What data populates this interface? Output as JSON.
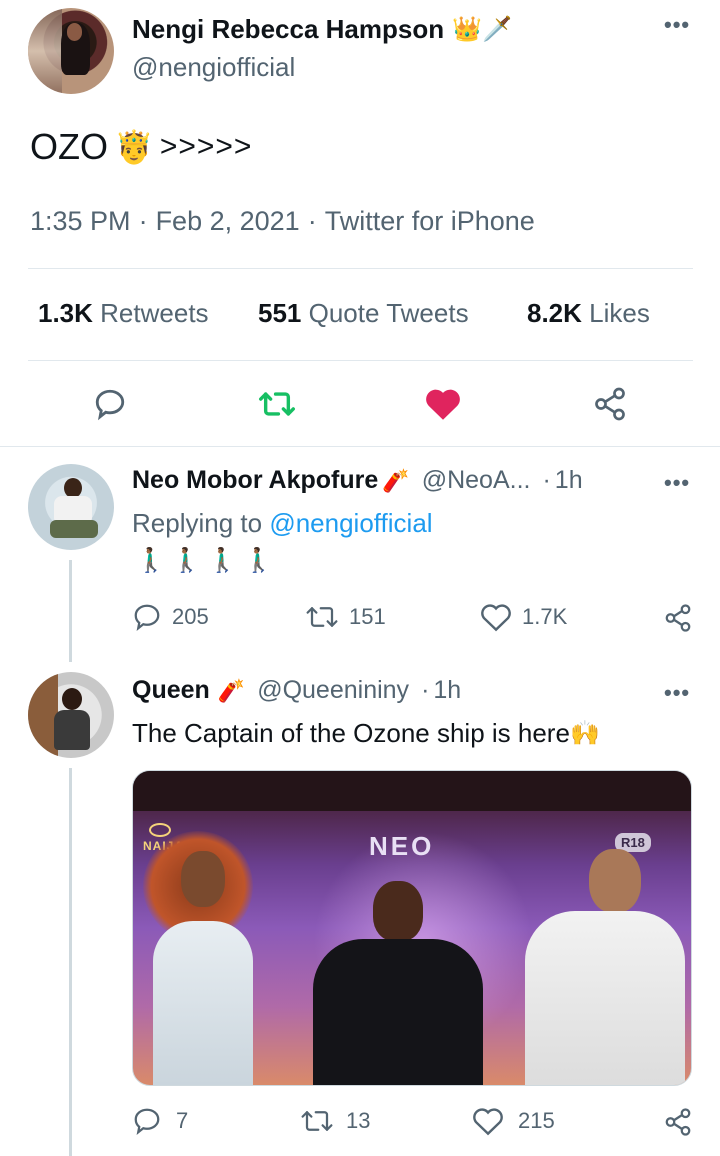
{
  "main_tweet": {
    "author_name": "Nengi Rebecca Hampson",
    "name_emoji": "👑🗡️",
    "handle": "@nengiofficial",
    "text": "OZO",
    "text_emoji": "🤴",
    "text_suffix": ">>>>>",
    "time": "1:35 PM",
    "date": "Feb 2, 2021",
    "client": "Twitter for iPhone",
    "retweets_count": "1.3K",
    "retweets_label": "Retweets",
    "quotes_count": "551",
    "quotes_label": "Quote Tweets",
    "likes_count": "8.2K",
    "likes_label": "Likes"
  },
  "replies": [
    {
      "author_name": "Neo Mobor Akpofure",
      "name_emoji": "🧨",
      "handle": "@NeoA...",
      "age": "1h",
      "replying_to_label": "Replying to",
      "replying_to": "@nengiofficial",
      "text": "🚶🏾‍♂️🚶🏾‍♂️🚶🏾‍♂️🚶🏾‍♂️",
      "replies": "205",
      "retweets": "151",
      "likes": "1.7K"
    },
    {
      "author_name": "Queen",
      "name_emoji": "🧨",
      "handle": "@Queenininy",
      "age": "1h",
      "text": "The Captain of the Ozone ship is here",
      "text_emoji": "🙌",
      "photo_text_neo": "NEO",
      "photo_text_r18": "R18",
      "photo_text_bbn": "NAIJA",
      "replies": "7",
      "retweets": "13",
      "likes": "215"
    }
  ],
  "colors": {
    "retweet_green": "#17bf63",
    "like_red": "#e0245e",
    "link_blue": "#1d9bf0",
    "gray": "#536471"
  }
}
